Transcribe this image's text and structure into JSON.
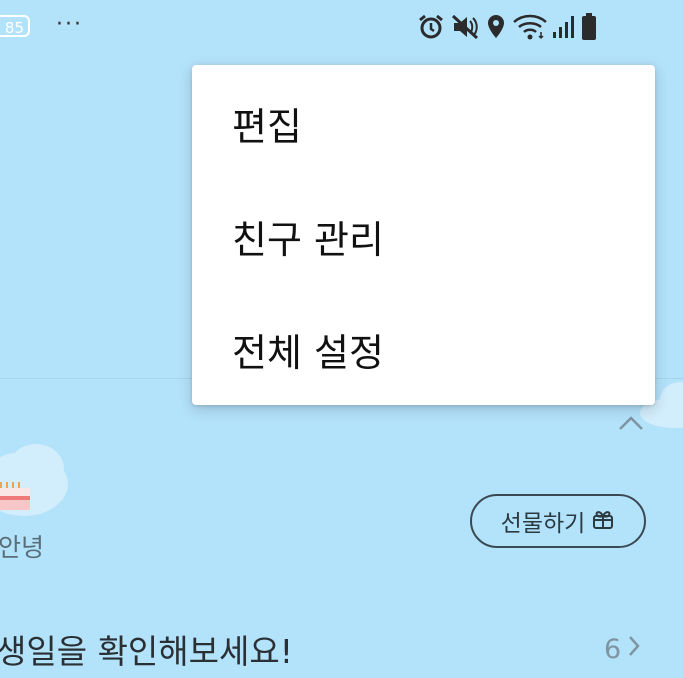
{
  "status_bar": {
    "battery_badge": "85",
    "more_label": "···"
  },
  "menu": {
    "items": [
      {
        "label": "편집"
      },
      {
        "label": "친구 관리"
      },
      {
        "label": "전체 설정"
      }
    ]
  },
  "birthday": {
    "friend_name": "안녕",
    "gift_button_label": "선물하기",
    "title": "생일을 확인해보세요!",
    "count": "6"
  },
  "colors": {
    "background": "#b3e2fb",
    "menu_background": "#ffffff",
    "button_border": "#3b4a52"
  }
}
